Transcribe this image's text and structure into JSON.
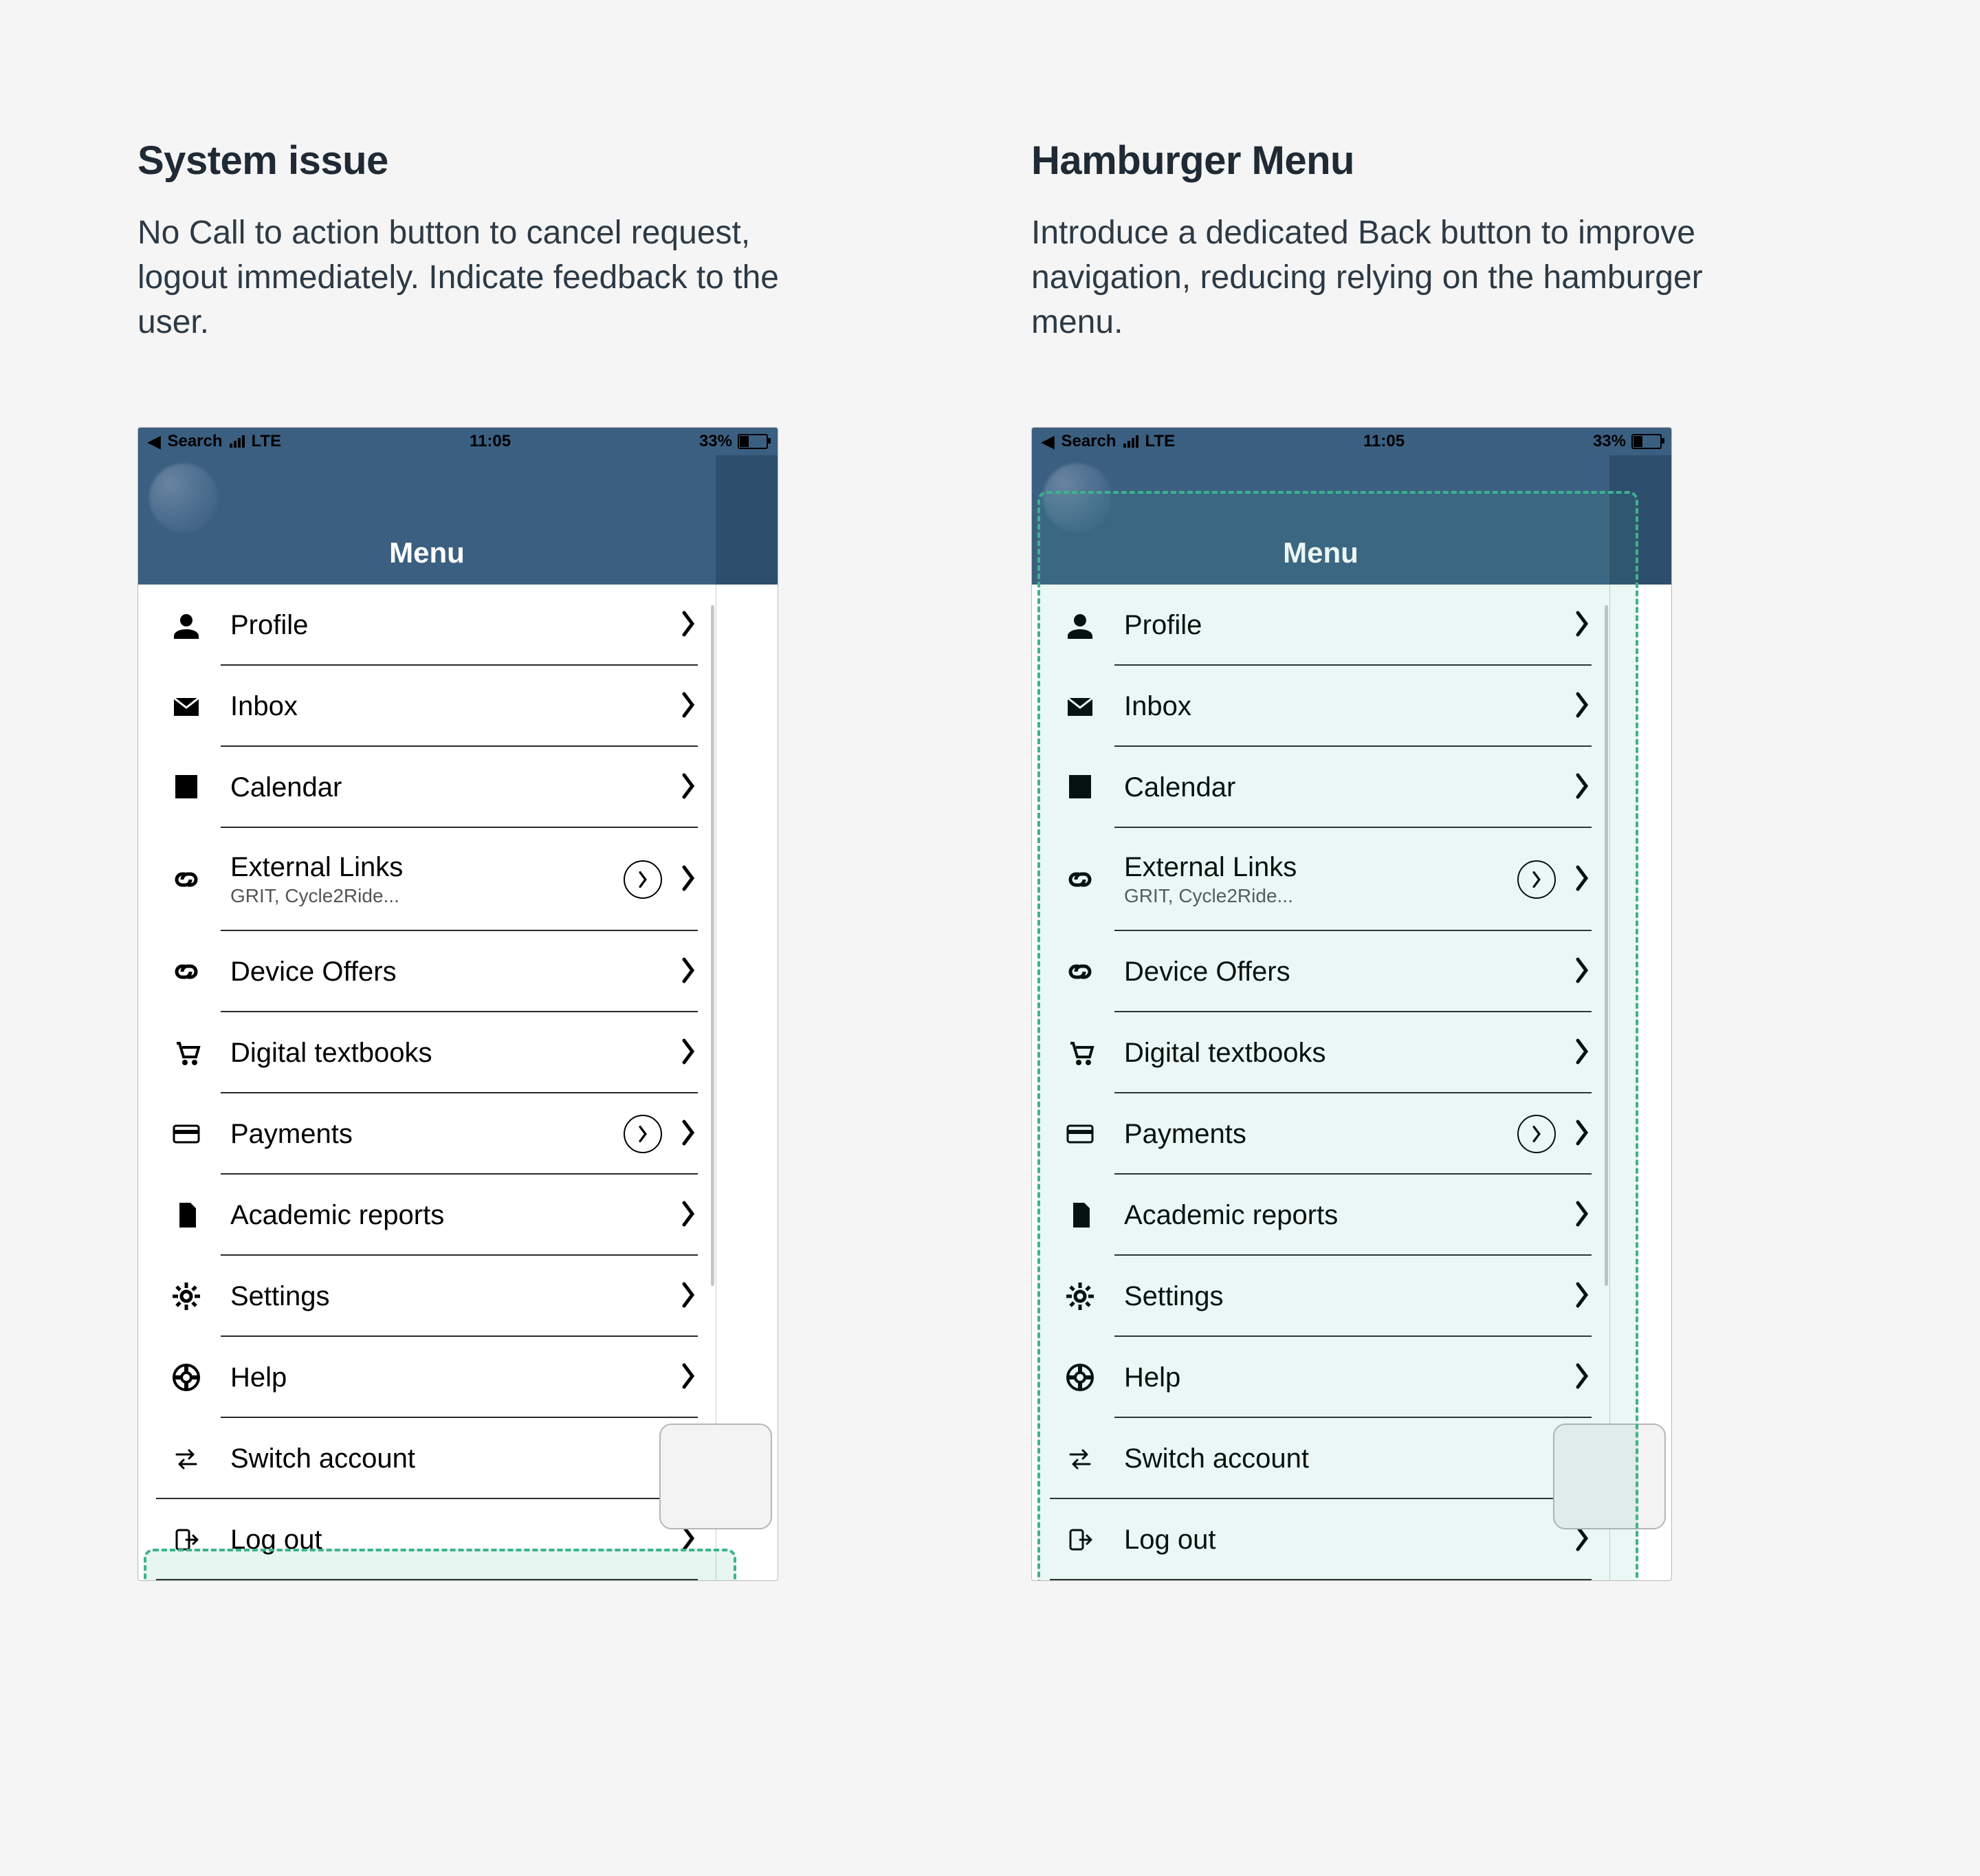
{
  "left": {
    "heading": "System issue",
    "description": "No Call to action button to cancel request, logout immediately. Indicate feedback to the user."
  },
  "right": {
    "heading": "Hamburger Menu",
    "description": "Introduce a dedicated Back button to improve navigation, reducing relying on the hamburger menu."
  },
  "status": {
    "back": "Search",
    "network": "LTE",
    "time": "11:05",
    "battery": "33%"
  },
  "nav": {
    "title": "Menu"
  },
  "menu": [
    {
      "key": "profile",
      "label": "Profile",
      "icon": "person"
    },
    {
      "key": "inbox",
      "label": "Inbox",
      "icon": "mail"
    },
    {
      "key": "calendar",
      "label": "Calendar",
      "icon": "calendar"
    },
    {
      "key": "external",
      "label": "External Links",
      "sub": "GRIT, Cycle2Ride...",
      "icon": "link",
      "circled": true
    },
    {
      "key": "device",
      "label": "Device Offers",
      "icon": "link"
    },
    {
      "key": "textbooks",
      "label": "Digital textbooks",
      "icon": "cart"
    },
    {
      "key": "payments",
      "label": "Payments",
      "icon": "card",
      "circled": true
    },
    {
      "key": "reports",
      "label": "Academic reports",
      "icon": "doc"
    },
    {
      "key": "settings",
      "label": "Settings",
      "icon": "gear"
    },
    {
      "key": "help",
      "label": "Help",
      "icon": "lifebuoy"
    },
    {
      "key": "switch",
      "label": "Switch account",
      "icon": "swap"
    },
    {
      "key": "logout",
      "label": "Log out",
      "icon": "logout"
    }
  ]
}
